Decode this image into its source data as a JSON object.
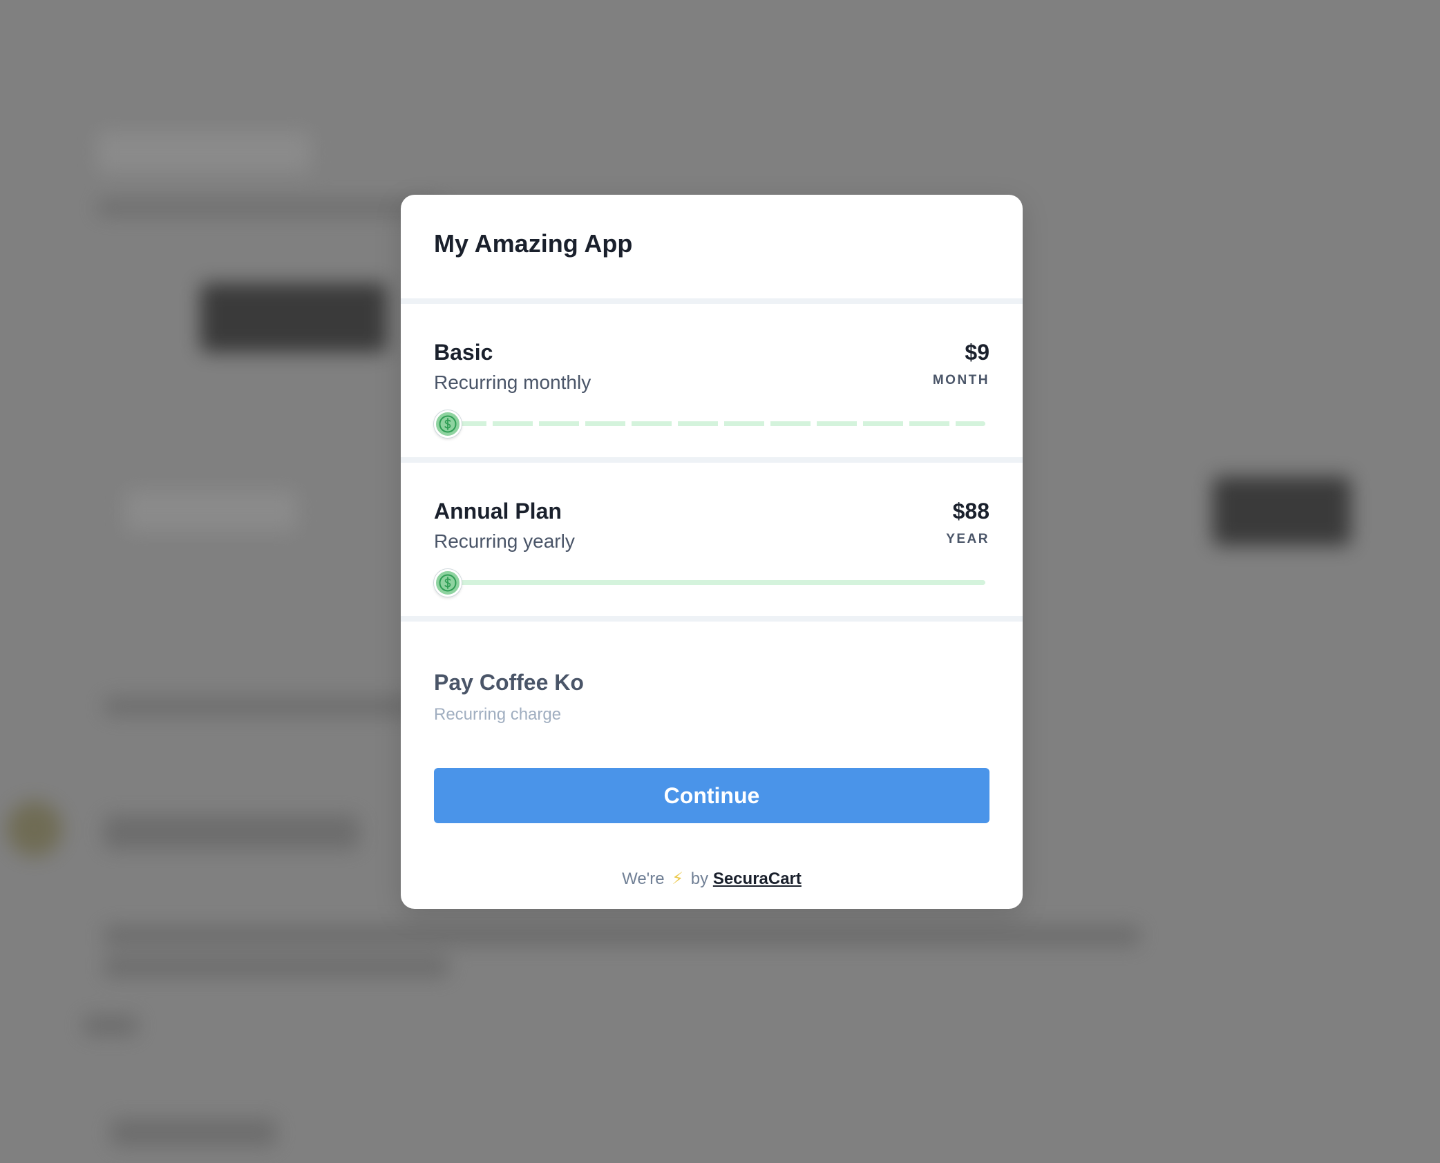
{
  "app": {
    "title": "My Amazing App"
  },
  "plans": [
    {
      "name": "Basic",
      "description": "Recurring monthly",
      "price": "$9",
      "period": "MONTH",
      "icon": "dollar-coin-icon",
      "track_style": "dashed"
    },
    {
      "name": "Annual Plan",
      "description": "Recurring yearly",
      "price": "$88",
      "period": "YEAR",
      "icon": "dollar-coin-icon",
      "track_style": "solid"
    }
  ],
  "other_payment": {
    "name": "Pay Coffee Ko",
    "description": "Recurring charge"
  },
  "continue_label": "Continue",
  "footer": {
    "prefix": "We're",
    "icon": "lightning-bolt-icon",
    "bolt_glyph": "⚡",
    "middle": "by",
    "link_text": "SecuraCart"
  },
  "colors": {
    "accent": "#4a94e9",
    "track": "#d4f3dc",
    "coin": "#8fd3a0",
    "overlay": "#808080"
  }
}
